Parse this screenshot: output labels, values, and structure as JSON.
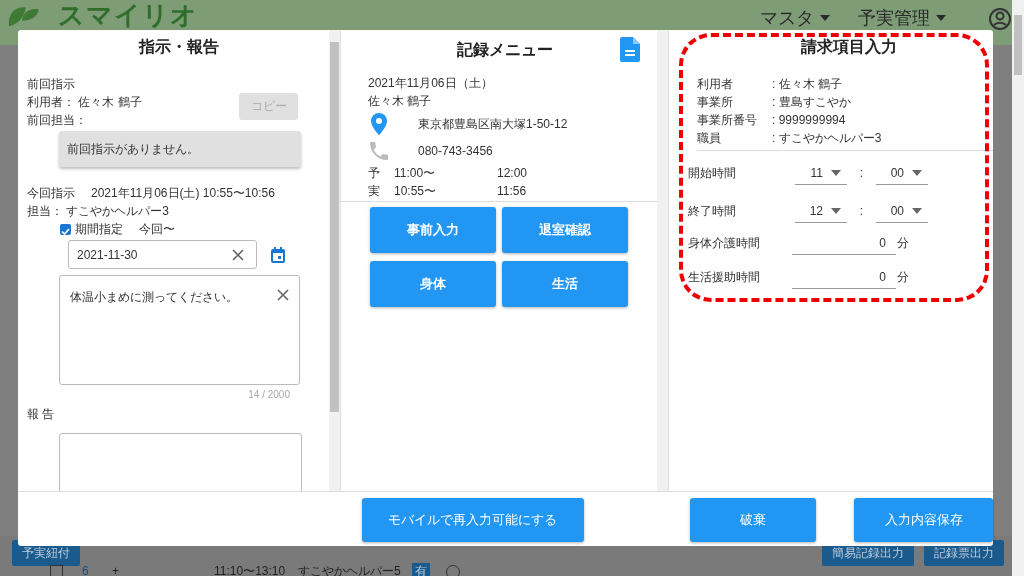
{
  "app": {
    "logo": "スマイリオ",
    "menus": [
      "マスタ",
      "予実管理"
    ]
  },
  "background": {
    "left_buttons": [
      "予実紐付"
    ],
    "right_buttons": [
      "簡易記録出力",
      "記録票出力"
    ],
    "row": {
      "checked": false,
      "number": "6",
      "expand": "+",
      "time": "11:10〜13:10",
      "staff": "すこやかヘルパー5",
      "badge": "有"
    }
  },
  "dialog": {
    "instructions": {
      "title": "指示・報告",
      "previous_label": "前回指示",
      "user": "利用者： 佐々木 鶴子",
      "previous_staff": "前回担当：",
      "copy_button": {
        "label": "コピー",
        "disabled": true
      },
      "previous_message": "前回指示がありません。",
      "current_label": "今回指示",
      "current_datetime": "2021年11月06日(土) 10:55〜10:56",
      "staff": "担当： すこやかヘルパー3",
      "period": {
        "label": "期間指定",
        "checked": true,
        "from": "今回〜"
      },
      "date_value": "2021-11-30",
      "instruction_text": "体温小まめに測ってください。",
      "counter": "14 / 2000",
      "report_label": "報 告"
    },
    "record_menu": {
      "title": "記録メニュー",
      "date": "2021年11月06日（土）",
      "user": "佐々木 鶴子",
      "address": "東京都豊島区南大塚1-50-12",
      "phone": "080-743-3456",
      "times": [
        {
          "label": "予",
          "start": "11:00〜",
          "end": "12:00"
        },
        {
          "label": "実",
          "start": "10:55〜",
          "end": "11:56"
        }
      ],
      "buttons": [
        "事前入力",
        "退室確認",
        "身体",
        "生活"
      ]
    },
    "billing": {
      "title": "請求項目入力",
      "info": [
        {
          "label": "利用者",
          "value": ": 佐々木 鶴子"
        },
        {
          "label": "事業所",
          "value": ": 豊島すこやか"
        },
        {
          "label": "事業所番号",
          "value": ": 9999999994"
        },
        {
          "label": "職員",
          "value": ": すこやかヘルパー3"
        }
      ],
      "times": [
        {
          "label": "開始時間",
          "hour": "11",
          "separator": ":",
          "minute": "00"
        },
        {
          "label": "終了時間",
          "hour": "12",
          "separator": ":",
          "minute": "00"
        }
      ],
      "durations": [
        {
          "label": "身体介護時間",
          "value": "0",
          "unit": "分"
        },
        {
          "label": "生活援助時間",
          "value": "0",
          "unit": "分"
        }
      ]
    },
    "footer_buttons": [
      "モバイルで再入力可能にする",
      "破棄",
      "入力内容保存"
    ]
  }
}
